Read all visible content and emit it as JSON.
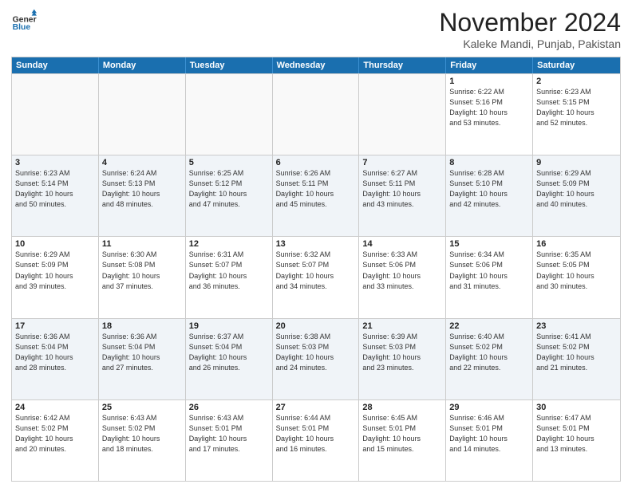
{
  "header": {
    "logo_general": "General",
    "logo_blue": "Blue",
    "month_title": "November 2024",
    "location": "Kaleke Mandi, Punjab, Pakistan"
  },
  "weekdays": [
    "Sunday",
    "Monday",
    "Tuesday",
    "Wednesday",
    "Thursday",
    "Friday",
    "Saturday"
  ],
  "rows": [
    [
      {
        "day": "",
        "info": "",
        "empty": true
      },
      {
        "day": "",
        "info": "",
        "empty": true
      },
      {
        "day": "",
        "info": "",
        "empty": true
      },
      {
        "day": "",
        "info": "",
        "empty": true
      },
      {
        "day": "",
        "info": "",
        "empty": true
      },
      {
        "day": "1",
        "info": "Sunrise: 6:22 AM\nSunset: 5:16 PM\nDaylight: 10 hours\nand 53 minutes.",
        "empty": false
      },
      {
        "day": "2",
        "info": "Sunrise: 6:23 AM\nSunset: 5:15 PM\nDaylight: 10 hours\nand 52 minutes.",
        "empty": false
      }
    ],
    [
      {
        "day": "3",
        "info": "Sunrise: 6:23 AM\nSunset: 5:14 PM\nDaylight: 10 hours\nand 50 minutes.",
        "empty": false
      },
      {
        "day": "4",
        "info": "Sunrise: 6:24 AM\nSunset: 5:13 PM\nDaylight: 10 hours\nand 48 minutes.",
        "empty": false
      },
      {
        "day": "5",
        "info": "Sunrise: 6:25 AM\nSunset: 5:12 PM\nDaylight: 10 hours\nand 47 minutes.",
        "empty": false
      },
      {
        "day": "6",
        "info": "Sunrise: 6:26 AM\nSunset: 5:11 PM\nDaylight: 10 hours\nand 45 minutes.",
        "empty": false
      },
      {
        "day": "7",
        "info": "Sunrise: 6:27 AM\nSunset: 5:11 PM\nDaylight: 10 hours\nand 43 minutes.",
        "empty": false
      },
      {
        "day": "8",
        "info": "Sunrise: 6:28 AM\nSunset: 5:10 PM\nDaylight: 10 hours\nand 42 minutes.",
        "empty": false
      },
      {
        "day": "9",
        "info": "Sunrise: 6:29 AM\nSunset: 5:09 PM\nDaylight: 10 hours\nand 40 minutes.",
        "empty": false
      }
    ],
    [
      {
        "day": "10",
        "info": "Sunrise: 6:29 AM\nSunset: 5:09 PM\nDaylight: 10 hours\nand 39 minutes.",
        "empty": false
      },
      {
        "day": "11",
        "info": "Sunrise: 6:30 AM\nSunset: 5:08 PM\nDaylight: 10 hours\nand 37 minutes.",
        "empty": false
      },
      {
        "day": "12",
        "info": "Sunrise: 6:31 AM\nSunset: 5:07 PM\nDaylight: 10 hours\nand 36 minutes.",
        "empty": false
      },
      {
        "day": "13",
        "info": "Sunrise: 6:32 AM\nSunset: 5:07 PM\nDaylight: 10 hours\nand 34 minutes.",
        "empty": false
      },
      {
        "day": "14",
        "info": "Sunrise: 6:33 AM\nSunset: 5:06 PM\nDaylight: 10 hours\nand 33 minutes.",
        "empty": false
      },
      {
        "day": "15",
        "info": "Sunrise: 6:34 AM\nSunset: 5:06 PM\nDaylight: 10 hours\nand 31 minutes.",
        "empty": false
      },
      {
        "day": "16",
        "info": "Sunrise: 6:35 AM\nSunset: 5:05 PM\nDaylight: 10 hours\nand 30 minutes.",
        "empty": false
      }
    ],
    [
      {
        "day": "17",
        "info": "Sunrise: 6:36 AM\nSunset: 5:04 PM\nDaylight: 10 hours\nand 28 minutes.",
        "empty": false
      },
      {
        "day": "18",
        "info": "Sunrise: 6:36 AM\nSunset: 5:04 PM\nDaylight: 10 hours\nand 27 minutes.",
        "empty": false
      },
      {
        "day": "19",
        "info": "Sunrise: 6:37 AM\nSunset: 5:04 PM\nDaylight: 10 hours\nand 26 minutes.",
        "empty": false
      },
      {
        "day": "20",
        "info": "Sunrise: 6:38 AM\nSunset: 5:03 PM\nDaylight: 10 hours\nand 24 minutes.",
        "empty": false
      },
      {
        "day": "21",
        "info": "Sunrise: 6:39 AM\nSunset: 5:03 PM\nDaylight: 10 hours\nand 23 minutes.",
        "empty": false
      },
      {
        "day": "22",
        "info": "Sunrise: 6:40 AM\nSunset: 5:02 PM\nDaylight: 10 hours\nand 22 minutes.",
        "empty": false
      },
      {
        "day": "23",
        "info": "Sunrise: 6:41 AM\nSunset: 5:02 PM\nDaylight: 10 hours\nand 21 minutes.",
        "empty": false
      }
    ],
    [
      {
        "day": "24",
        "info": "Sunrise: 6:42 AM\nSunset: 5:02 PM\nDaylight: 10 hours\nand 20 minutes.",
        "empty": false
      },
      {
        "day": "25",
        "info": "Sunrise: 6:43 AM\nSunset: 5:02 PM\nDaylight: 10 hours\nand 18 minutes.",
        "empty": false
      },
      {
        "day": "26",
        "info": "Sunrise: 6:43 AM\nSunset: 5:01 PM\nDaylight: 10 hours\nand 17 minutes.",
        "empty": false
      },
      {
        "day": "27",
        "info": "Sunrise: 6:44 AM\nSunset: 5:01 PM\nDaylight: 10 hours\nand 16 minutes.",
        "empty": false
      },
      {
        "day": "28",
        "info": "Sunrise: 6:45 AM\nSunset: 5:01 PM\nDaylight: 10 hours\nand 15 minutes.",
        "empty": false
      },
      {
        "day": "29",
        "info": "Sunrise: 6:46 AM\nSunset: 5:01 PM\nDaylight: 10 hours\nand 14 minutes.",
        "empty": false
      },
      {
        "day": "30",
        "info": "Sunrise: 6:47 AM\nSunset: 5:01 PM\nDaylight: 10 hours\nand 13 minutes.",
        "empty": false
      }
    ]
  ]
}
